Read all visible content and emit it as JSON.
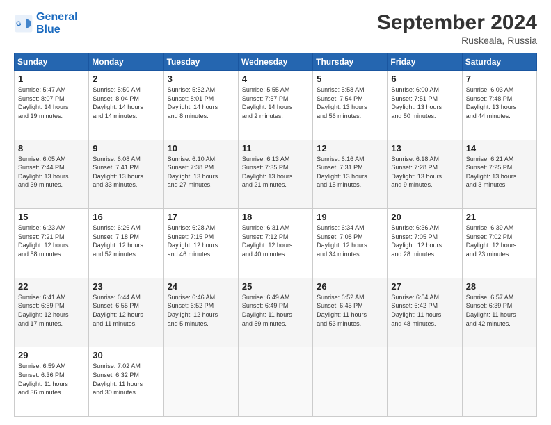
{
  "header": {
    "logo_line1": "General",
    "logo_line2": "Blue",
    "title": "September 2024",
    "subtitle": "Ruskeala, Russia"
  },
  "weekdays": [
    "Sunday",
    "Monday",
    "Tuesday",
    "Wednesday",
    "Thursday",
    "Friday",
    "Saturday"
  ],
  "weeks": [
    [
      {
        "day": "1",
        "lines": [
          "Sunrise: 5:47 AM",
          "Sunset: 8:07 PM",
          "Daylight: 14 hours",
          "and 19 minutes."
        ]
      },
      {
        "day": "2",
        "lines": [
          "Sunrise: 5:50 AM",
          "Sunset: 8:04 PM",
          "Daylight: 14 hours",
          "and 14 minutes."
        ]
      },
      {
        "day": "3",
        "lines": [
          "Sunrise: 5:52 AM",
          "Sunset: 8:01 PM",
          "Daylight: 14 hours",
          "and 8 minutes."
        ]
      },
      {
        "day": "4",
        "lines": [
          "Sunrise: 5:55 AM",
          "Sunset: 7:57 PM",
          "Daylight: 14 hours",
          "and 2 minutes."
        ]
      },
      {
        "day": "5",
        "lines": [
          "Sunrise: 5:58 AM",
          "Sunset: 7:54 PM",
          "Daylight: 13 hours",
          "and 56 minutes."
        ]
      },
      {
        "day": "6",
        "lines": [
          "Sunrise: 6:00 AM",
          "Sunset: 7:51 PM",
          "Daylight: 13 hours",
          "and 50 minutes."
        ]
      },
      {
        "day": "7",
        "lines": [
          "Sunrise: 6:03 AM",
          "Sunset: 7:48 PM",
          "Daylight: 13 hours",
          "and 44 minutes."
        ]
      }
    ],
    [
      {
        "day": "8",
        "lines": [
          "Sunrise: 6:05 AM",
          "Sunset: 7:44 PM",
          "Daylight: 13 hours",
          "and 39 minutes."
        ]
      },
      {
        "day": "9",
        "lines": [
          "Sunrise: 6:08 AM",
          "Sunset: 7:41 PM",
          "Daylight: 13 hours",
          "and 33 minutes."
        ]
      },
      {
        "day": "10",
        "lines": [
          "Sunrise: 6:10 AM",
          "Sunset: 7:38 PM",
          "Daylight: 13 hours",
          "and 27 minutes."
        ]
      },
      {
        "day": "11",
        "lines": [
          "Sunrise: 6:13 AM",
          "Sunset: 7:35 PM",
          "Daylight: 13 hours",
          "and 21 minutes."
        ]
      },
      {
        "day": "12",
        "lines": [
          "Sunrise: 6:16 AM",
          "Sunset: 7:31 PM",
          "Daylight: 13 hours",
          "and 15 minutes."
        ]
      },
      {
        "day": "13",
        "lines": [
          "Sunrise: 6:18 AM",
          "Sunset: 7:28 PM",
          "Daylight: 13 hours",
          "and 9 minutes."
        ]
      },
      {
        "day": "14",
        "lines": [
          "Sunrise: 6:21 AM",
          "Sunset: 7:25 PM",
          "Daylight: 13 hours",
          "and 3 minutes."
        ]
      }
    ],
    [
      {
        "day": "15",
        "lines": [
          "Sunrise: 6:23 AM",
          "Sunset: 7:21 PM",
          "Daylight: 12 hours",
          "and 58 minutes."
        ]
      },
      {
        "day": "16",
        "lines": [
          "Sunrise: 6:26 AM",
          "Sunset: 7:18 PM",
          "Daylight: 12 hours",
          "and 52 minutes."
        ]
      },
      {
        "day": "17",
        "lines": [
          "Sunrise: 6:28 AM",
          "Sunset: 7:15 PM",
          "Daylight: 12 hours",
          "and 46 minutes."
        ]
      },
      {
        "day": "18",
        "lines": [
          "Sunrise: 6:31 AM",
          "Sunset: 7:12 PM",
          "Daylight: 12 hours",
          "and 40 minutes."
        ]
      },
      {
        "day": "19",
        "lines": [
          "Sunrise: 6:34 AM",
          "Sunset: 7:08 PM",
          "Daylight: 12 hours",
          "and 34 minutes."
        ]
      },
      {
        "day": "20",
        "lines": [
          "Sunrise: 6:36 AM",
          "Sunset: 7:05 PM",
          "Daylight: 12 hours",
          "and 28 minutes."
        ]
      },
      {
        "day": "21",
        "lines": [
          "Sunrise: 6:39 AM",
          "Sunset: 7:02 PM",
          "Daylight: 12 hours",
          "and 23 minutes."
        ]
      }
    ],
    [
      {
        "day": "22",
        "lines": [
          "Sunrise: 6:41 AM",
          "Sunset: 6:59 PM",
          "Daylight: 12 hours",
          "and 17 minutes."
        ]
      },
      {
        "day": "23",
        "lines": [
          "Sunrise: 6:44 AM",
          "Sunset: 6:55 PM",
          "Daylight: 12 hours",
          "and 11 minutes."
        ]
      },
      {
        "day": "24",
        "lines": [
          "Sunrise: 6:46 AM",
          "Sunset: 6:52 PM",
          "Daylight: 12 hours",
          "and 5 minutes."
        ]
      },
      {
        "day": "25",
        "lines": [
          "Sunrise: 6:49 AM",
          "Sunset: 6:49 PM",
          "Daylight: 11 hours",
          "and 59 minutes."
        ]
      },
      {
        "day": "26",
        "lines": [
          "Sunrise: 6:52 AM",
          "Sunset: 6:45 PM",
          "Daylight: 11 hours",
          "and 53 minutes."
        ]
      },
      {
        "day": "27",
        "lines": [
          "Sunrise: 6:54 AM",
          "Sunset: 6:42 PM",
          "Daylight: 11 hours",
          "and 48 minutes."
        ]
      },
      {
        "day": "28",
        "lines": [
          "Sunrise: 6:57 AM",
          "Sunset: 6:39 PM",
          "Daylight: 11 hours",
          "and 42 minutes."
        ]
      }
    ],
    [
      {
        "day": "29",
        "lines": [
          "Sunrise: 6:59 AM",
          "Sunset: 6:36 PM",
          "Daylight: 11 hours",
          "and 36 minutes."
        ]
      },
      {
        "day": "30",
        "lines": [
          "Sunrise: 7:02 AM",
          "Sunset: 6:32 PM",
          "Daylight: 11 hours",
          "and 30 minutes."
        ]
      },
      {
        "day": "",
        "lines": []
      },
      {
        "day": "",
        "lines": []
      },
      {
        "day": "",
        "lines": []
      },
      {
        "day": "",
        "lines": []
      },
      {
        "day": "",
        "lines": []
      }
    ]
  ]
}
